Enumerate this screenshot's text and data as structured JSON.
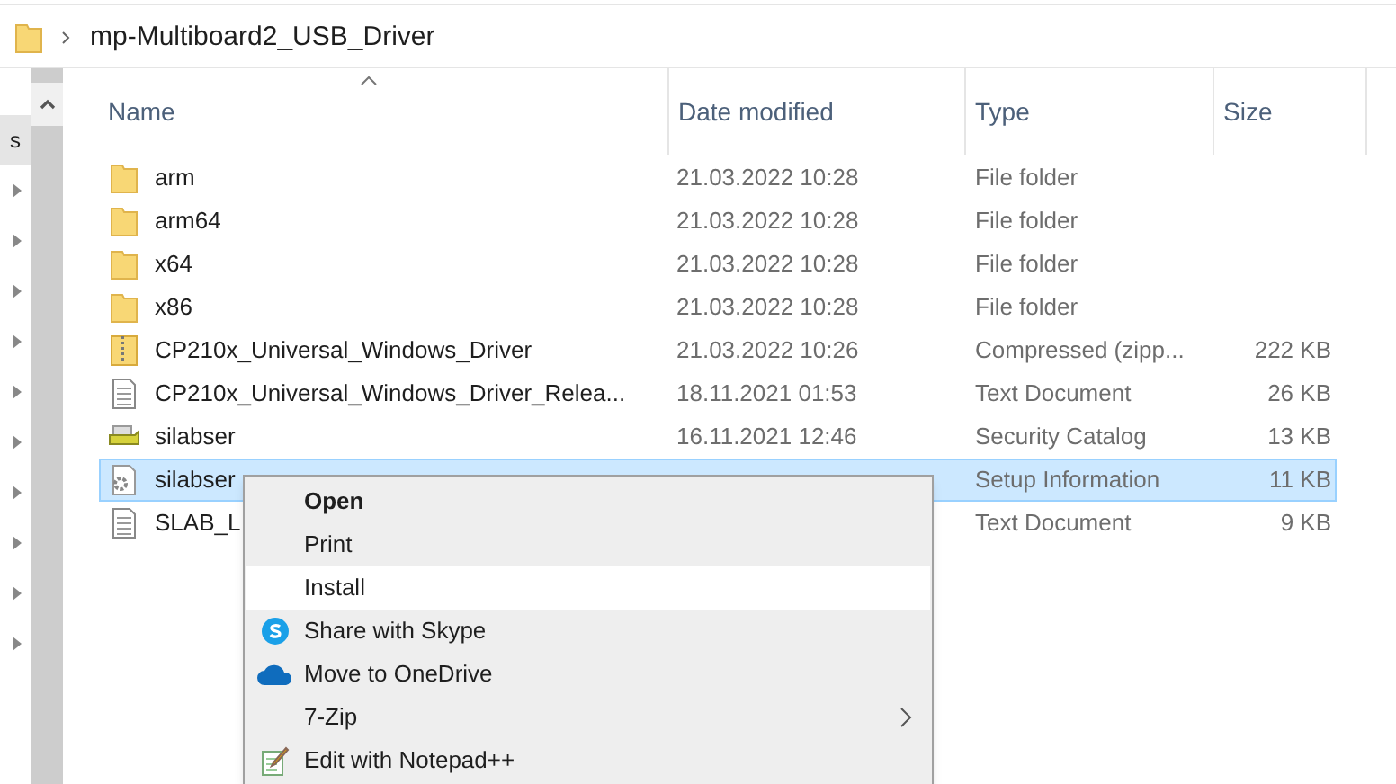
{
  "address_bar": {
    "path": [
      "mp-Multiboard2_USB_Driver"
    ]
  },
  "nav_pane": {
    "items": [
      {
        "label": "s",
        "selected": true
      },
      {
        "selected": false,
        "expanded": false
      },
      {
        "selected": false,
        "expanded": false
      },
      {
        "selected": false,
        "expanded": false
      },
      {
        "selected": false,
        "expanded": false
      },
      {
        "selected": false,
        "expanded": false
      },
      {
        "selected": false,
        "expanded": false
      },
      {
        "selected": false,
        "expanded": false
      },
      {
        "selected": false,
        "expanded": false
      },
      {
        "selected": false,
        "expanded": false
      },
      {
        "selected": false,
        "expanded": false
      }
    ]
  },
  "table": {
    "columns": [
      {
        "label": "Name",
        "sorted": true
      },
      {
        "label": "Date modified",
        "sorted": false
      },
      {
        "label": "Type",
        "sorted": false
      },
      {
        "label": "Size",
        "sorted": false
      }
    ],
    "rows": [
      {
        "kind": "folder",
        "name": "arm",
        "date": "21.03.2022 10:28",
        "type": "File folder",
        "selected": false
      },
      {
        "kind": "folder",
        "name": "arm64",
        "date": "21.03.2022 10:28",
        "type": "File folder",
        "selected": false
      },
      {
        "kind": "folder",
        "name": "x64",
        "date": "21.03.2022 10:28",
        "type": "File folder",
        "selected": false
      },
      {
        "kind": "folder",
        "name": "x86",
        "date": "21.03.2022 10:28",
        "type": "File folder",
        "selected": false
      },
      {
        "kind": "zip",
        "name": "CP210x_Universal_Windows_Driver",
        "date": "21.03.2022 10:26",
        "type": "Compressed (zipp...",
        "size": "222 KB",
        "selected": false
      },
      {
        "kind": "text",
        "name": "CP210x_Universal_Windows_Driver_Relea...",
        "date": "18.11.2021 01:53",
        "type": "Text Document",
        "size": "26 KB",
        "selected": false
      },
      {
        "kind": "catalog",
        "name": "silabser",
        "date": "16.11.2021 12:46",
        "type": "Security Catalog",
        "size": "13 KB",
        "selected": false
      },
      {
        "kind": "setup",
        "name": "silabser",
        "type": "Setup Information",
        "size": "11 KB",
        "selected": true
      },
      {
        "kind": "text",
        "name": "SLAB_L",
        "type": "Text Document",
        "size": "9 KB",
        "selected": false
      }
    ]
  },
  "context_menu": {
    "items": [
      {
        "kind": "plain",
        "label": "Open",
        "default": true,
        "selected": false,
        "submenu": false
      },
      {
        "kind": "plain",
        "label": "Print",
        "default": false,
        "selected": false,
        "submenu": false
      },
      {
        "kind": "plain",
        "label": "Install",
        "default": false,
        "selected": true,
        "submenu": false
      },
      {
        "kind": "skype",
        "label": "Share with Skype",
        "default": false,
        "selected": false,
        "submenu": false
      },
      {
        "kind": "cloud",
        "label": "Move to OneDrive",
        "default": false,
        "selected": false,
        "submenu": false
      },
      {
        "kind": "plain",
        "label": "7-Zip",
        "default": false,
        "selected": false,
        "submenu": true
      },
      {
        "kind": "notepad",
        "label": "Edit with Notepad++",
        "default": false,
        "selected": false,
        "submenu": false
      }
    ]
  }
}
